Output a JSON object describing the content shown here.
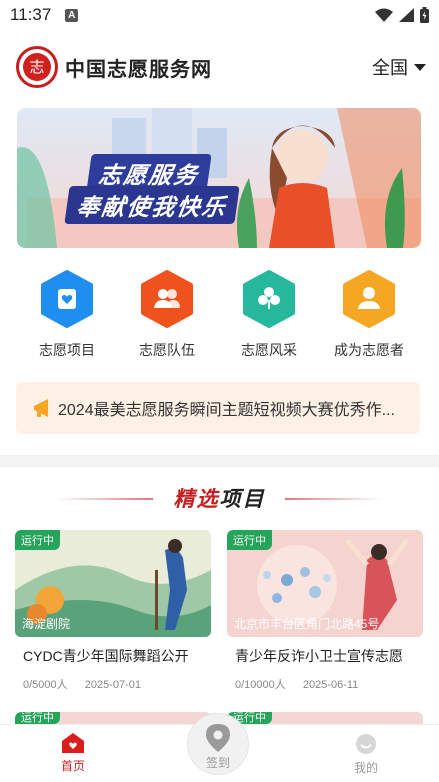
{
  "status_bar": {
    "time": "11:37",
    "notification_icon": "A"
  },
  "header": {
    "title": "中国志愿服务网",
    "region_label": "全国",
    "logo_glyph": "志"
  },
  "banner": {
    "line1": "志愿服务",
    "line2": "奉献使我快乐"
  },
  "quick_actions": [
    {
      "label": "志愿项目",
      "icon": "heart-card-icon",
      "color": "#1e8ef0"
    },
    {
      "label": "志愿队伍",
      "icon": "team-icon",
      "color": "#f0521e"
    },
    {
      "label": "志愿风采",
      "icon": "clover-icon",
      "color": "#26b89c"
    },
    {
      "label": "成为志愿者",
      "icon": "person-add-icon",
      "color": "#f5a623"
    }
  ],
  "notice": {
    "icon": "megaphone-icon",
    "text": "2024最美志愿服务瞬间主题短视频大赛优秀作..."
  },
  "section": {
    "title_red": "精选",
    "title_black": "项目"
  },
  "projects": [
    {
      "status": "运行中",
      "location": "海淀剧院",
      "title": "CYDC青少年国际舞蹈公开",
      "participants": "0/5000人",
      "date": "2025-07-01"
    },
    {
      "status": "运行中",
      "location": "北京市丰台区角门北路45号",
      "title": "青少年反诈小卫士宣传志愿",
      "participants": "0/10000人",
      "date": "2025-06-11"
    }
  ],
  "more_projects": [
    {
      "status": "运行中"
    },
    {
      "status": "运行中"
    }
  ],
  "tabbar": {
    "home": "首页",
    "signin": "签到",
    "mine": "我的"
  },
  "colors": {
    "brand_red": "#c81e1e",
    "status_green": "#25a55a",
    "notice_bg": "#fdf1e6"
  }
}
